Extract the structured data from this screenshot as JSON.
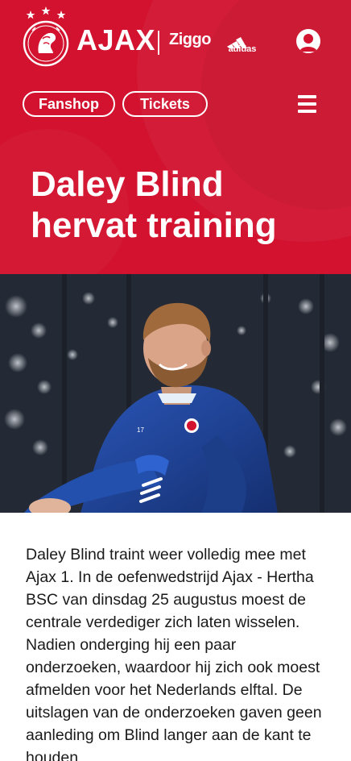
{
  "brand": {
    "name": "AJAX",
    "sponsor_1": "Ziggo",
    "sponsor_2": "adidas",
    "crest_label": "AJAX"
  },
  "nav": {
    "fanshop_label": "Fanshop",
    "tickets_label": "Tickets"
  },
  "icons": {
    "account": "user-icon",
    "menu": "hamburger-icon"
  },
  "article": {
    "title": "Daley Blind hervat training",
    "image_alt": "Daley Blind op training",
    "body": "Daley Blind traint weer volledig mee met Ajax 1. In de oefenwedstrijd Ajax - Hertha BSC van dinsdag 25 augustus moest de centrale verdediger zich laten wisselen. Nadien onderging hij een paar onderzoeken, waardoor hij zich ook moest afmelden voor het Nederlands elftal. De uitslagen van de onderzoeken gaven geen aanleding om Blind langer aan de kant te houden"
  },
  "colors": {
    "brand_red": "#d2122e",
    "white": "#ffffff",
    "text": "#1a1a1a",
    "shirt_blue": "#1f3f8f"
  }
}
